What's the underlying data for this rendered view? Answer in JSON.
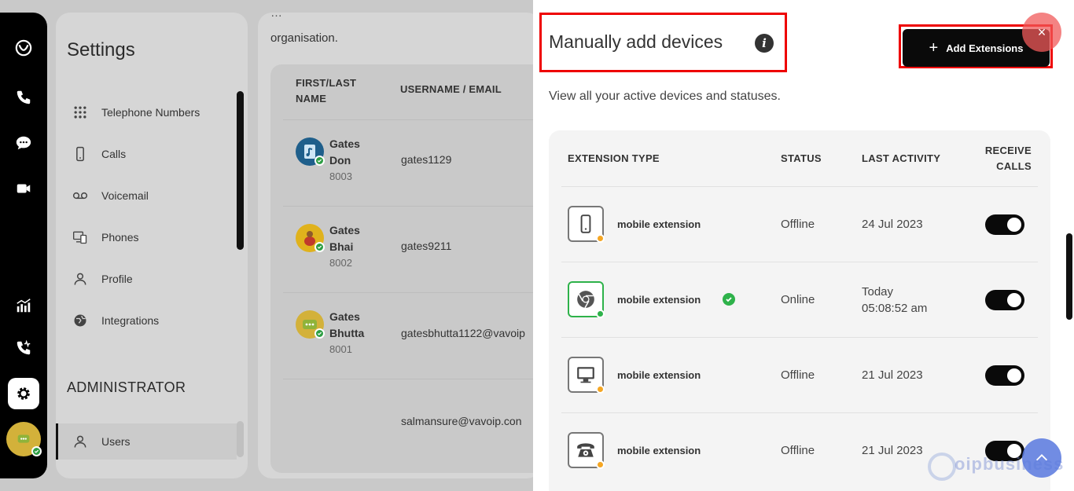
{
  "sidebar": {
    "title": "Settings",
    "items": [
      {
        "label": "Telephone Numbers",
        "icon": "grid-icon"
      },
      {
        "label": "Calls",
        "icon": "mobile-icon"
      },
      {
        "label": "Voicemail",
        "icon": "voicemail-icon"
      },
      {
        "label": "Phones",
        "icon": "phones-icon"
      },
      {
        "label": "Profile",
        "icon": "profile-icon"
      },
      {
        "label": "Integrations",
        "icon": "integrations-icon"
      }
    ],
    "section": "ADMINISTRATOR",
    "admin_items": [
      {
        "label": "Users",
        "icon": "profile-icon",
        "active": true
      }
    ]
  },
  "users": {
    "intro_cut": "…",
    "intro": "organisation.",
    "headers": {
      "name": "FIRST/LAST NAME",
      "email": "USERNAME / EMAIL"
    },
    "rows": [
      {
        "first": "Gates",
        "last": "Don",
        "ext": "8003",
        "email": "gates1129"
      },
      {
        "first": "Gates",
        "last": "Bhai",
        "ext": "8002",
        "email": "gates9211"
      },
      {
        "first": "Gates",
        "last": "Bhutta",
        "ext": "8001",
        "email": "gatesbhutta1122@vavoip"
      },
      {
        "first": "",
        "last": "",
        "ext": "",
        "email": "salmansure@vavoip.con"
      }
    ]
  },
  "drawer": {
    "title": "Manually add devices",
    "info": "i",
    "add_button": "Add Extensions",
    "add_plus": "+",
    "close": "×",
    "subtitle": "View all your active devices and statuses.",
    "headers": {
      "type": "EXTENSION TYPE",
      "status": "STATUS",
      "last": "LAST ACTIVITY",
      "receive1": "RECEIVE",
      "receive2": "CALLS"
    },
    "rows": [
      {
        "name": "mobile extension",
        "device": "mobile-icon",
        "status": "Offline",
        "last1": "24 Jul 2023",
        "last2": "",
        "online": false,
        "receive": true
      },
      {
        "name": "mobile extension",
        "device": "chrome-icon",
        "status": "Online",
        "last1": "Today",
        "last2": "05:08:52 am",
        "online": true,
        "receive": true
      },
      {
        "name": "mobile extension",
        "device": "desktop-icon",
        "status": "Offline",
        "last1": "21 Jul 2023",
        "last2": "",
        "online": false,
        "receive": true
      },
      {
        "name": "mobile extension",
        "device": "desk-phone-icon",
        "status": "Offline",
        "last1": "21 Jul 2023",
        "last2": "",
        "online": false,
        "receive": true
      }
    ]
  },
  "watermark": "oipbusiness",
  "colors": {
    "accent": "#0a0a0a",
    "online": "#2eb24a",
    "offline": "#f5a623",
    "highlight": "#ee0000"
  }
}
